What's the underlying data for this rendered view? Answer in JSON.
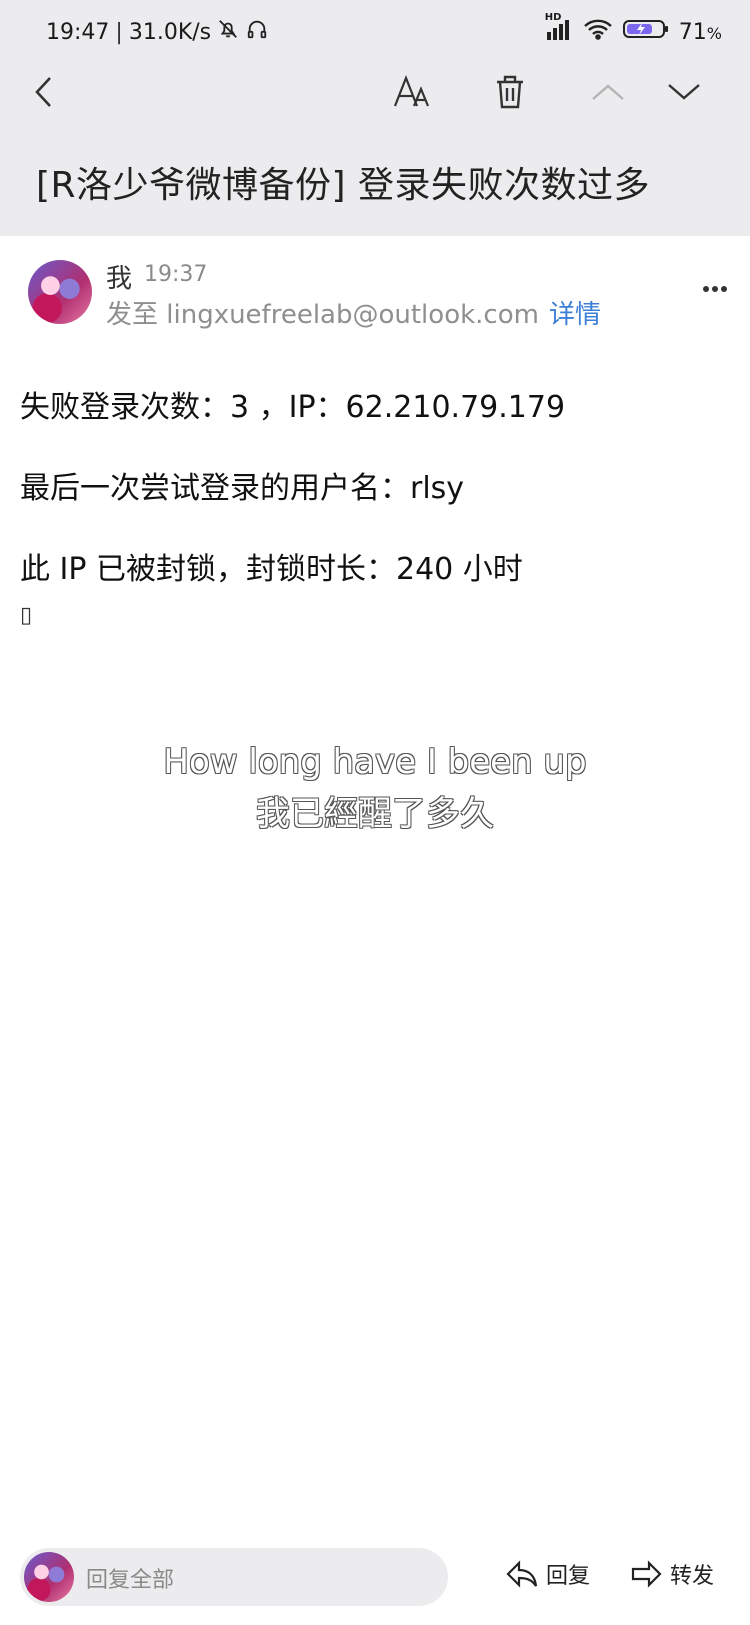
{
  "status_bar": {
    "time": "19:47",
    "net_speed": "31.0K/s",
    "battery": "71",
    "battery_unit": "%",
    "signal_badge": "HD",
    "icons": [
      "bell-off-icon",
      "headset-icon",
      "signal-icon",
      "wifi-icon",
      "battery-charging-icon"
    ]
  },
  "toolbar": {
    "icons": [
      "back-icon",
      "font-size-icon",
      "delete-icon",
      "prev-mail-icon",
      "next-mail-icon"
    ]
  },
  "email": {
    "subject": "[R洛少爷微博备份] 登录失败次数过多",
    "sender_name": "我",
    "sent_time": "19:37",
    "to_label": "发至 lingxuefreelab@outlook.com",
    "details_link": "详情",
    "body_lines": [
      "失败登录次数：3 ，IP：62.210.79.179",
      "最后一次尝试登录的用户名：rlsy",
      "此 IP 已被封锁，封锁时长：240 小时"
    ],
    "trailing_glyph": "▯"
  },
  "overlay_caption": {
    "line1": "How long have I been up",
    "line2": "我已經醒了多久"
  },
  "bottom_bar": {
    "reply_all_placeholder": "回复全部",
    "reply_label": "回复",
    "forward_label": "转发"
  },
  "colors": {
    "header_bg": "#ececee",
    "link": "#3d7fd6",
    "battery_fill": "#7b68ee"
  }
}
